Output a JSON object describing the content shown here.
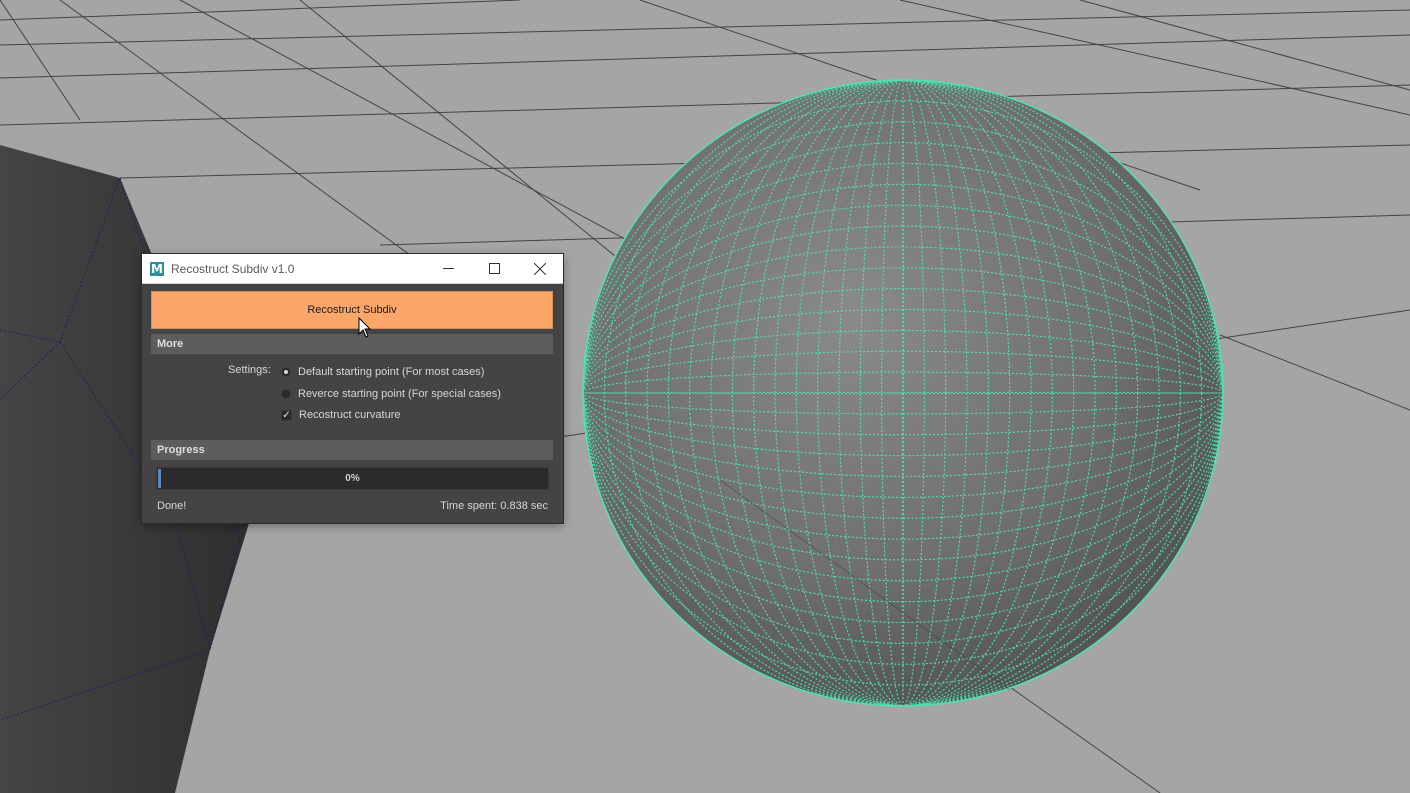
{
  "window": {
    "title": "Recostruct Subdiv v1.0",
    "app_icon_letter": "M",
    "controls": [
      "minimize-icon",
      "maximize-icon",
      "close-icon"
    ]
  },
  "actions": {
    "primary_button_label": "Recostruct Subdiv"
  },
  "sections": {
    "more_label": "More",
    "progress_label": "Progress"
  },
  "settings": {
    "label": "Settings:",
    "options": [
      {
        "label": "Default starting point (For most cases)",
        "type": "radio",
        "checked": true
      },
      {
        "label": "Reverce starting point (For special cases)",
        "type": "radio",
        "checked": false
      },
      {
        "label": "Recostruct curvature",
        "type": "checkbox",
        "checked": true
      }
    ]
  },
  "progress": {
    "value": 0,
    "text": "0%"
  },
  "status": {
    "message": "Done!",
    "time": "Time spent: 0.838 sec"
  },
  "colors": {
    "accent_button": "#fca769",
    "wireframe_selected": "#4fe3b0",
    "panel_bg": "#444444",
    "header_bg": "#5d5d5d",
    "viewport_bg": "#a6a6a6"
  }
}
